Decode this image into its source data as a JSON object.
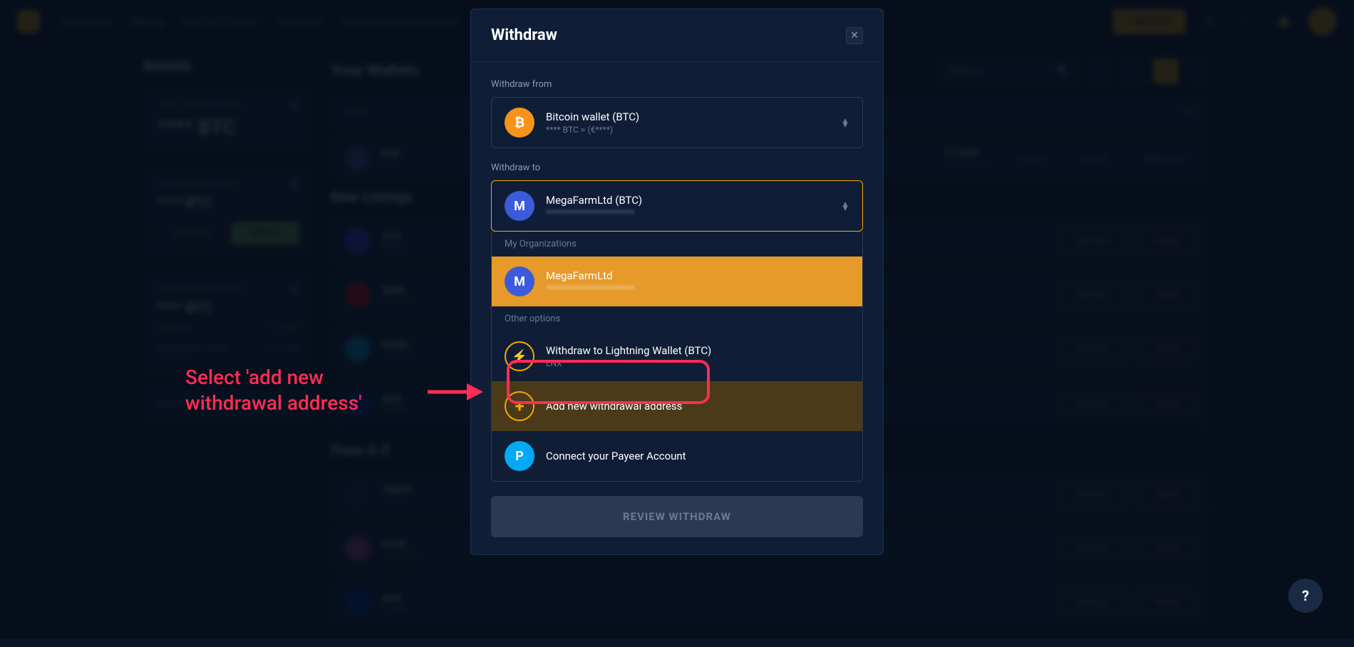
{
  "nav": {
    "links": [
      "Dashboard",
      "Mining",
      "Buy/Sell Crypto",
      "Exchange",
      "Hashpower Marketplace"
    ],
    "kyc_btn": "+ GET KYC"
  },
  "assets": {
    "title": "Assets",
    "total_label": "TOTAL ASSETS IN BTC",
    "total_value": "**** BTC",
    "avail_label": "AVAILABLE BALANCE",
    "avail_value": "**** BTC",
    "withdraw_btn": "WITHDRAW",
    "deposit_btn": "DEPOSIT",
    "pending_label": "PENDING & IN ORDERS",
    "pending_value": "**** BTC",
    "deposits_label": "Deposits",
    "deposits_value": "**** BTC",
    "hashpower_label": "Hashpower Orders",
    "hashpower_value": "**** BTC",
    "allocation_label": "ASSET ALLOCATION"
  },
  "wallets": {
    "title": "Your Wallets",
    "sort_label": "NAME",
    "type_label": "TYPE",
    "search_placeholder": "Search",
    "eur_sym": "EUR",
    "eur_name": "Euro",
    "eur_balance": "*** EUR",
    "eur_sub": "*** Tokens yet",
    "convert_btn": "Convert",
    "deposit_btn": "Deposit",
    "withdrawal_btn": "Withdrawal",
    "new_listings": "New Listings",
    "from_az": "From #-Z",
    "deposit_action": "DEPOSIT",
    "trade_action": "TRADE",
    "coins": [
      {
        "sym": "STX",
        "name": "Stacks"
      },
      {
        "sym": "SHIB",
        "name": "Shiba Inu"
      },
      {
        "sym": "SAND",
        "name": "Sandbox"
      },
      {
        "sym": "ADA",
        "name": "Cardano"
      },
      {
        "sym": "1INCH",
        "name": "1inch"
      },
      {
        "sym": "AAVE",
        "name": "Aave Token"
      },
      {
        "sym": "ADA",
        "name": "Cardano"
      }
    ]
  },
  "modal": {
    "title": "Withdraw",
    "from_label": "Withdraw from",
    "from_name": "Bitcoin wallet (BTC)",
    "from_sub": "**** BTC ≈ (€****)",
    "to_label": "Withdraw to",
    "to_name": "MegaFarmLtd (BTC)",
    "to_sub": "************************",
    "section_orgs": "My Organizations",
    "org_name": "MegaFarmLtd",
    "org_sub": "************************",
    "section_other": "Other options",
    "lightning_name": "Withdraw to Lightning Wallet (BTC)",
    "lightning_sub": "LNX",
    "add_address": "Add new withdrawal address",
    "payeer": "Connect your Payeer Account",
    "review_btn": "REVIEW WITHDRAW"
  },
  "annotation_line1": "Select 'add new",
  "annotation_line2": "withdrawal address'",
  "help": "?"
}
